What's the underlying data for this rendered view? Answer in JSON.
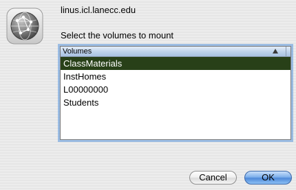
{
  "dialog": {
    "server": "linus.icl.lanecc.edu",
    "prompt": "Select the volumes to mount",
    "icon": "network-server-globe-icon"
  },
  "volumes_list": {
    "header": "Volumes",
    "sort_icon": "sort-ascending-icon",
    "items": [
      {
        "label": "ClassMaterials",
        "selected": true
      },
      {
        "label": "InstHomes",
        "selected": false
      },
      {
        "label": "L00000000",
        "selected": false
      },
      {
        "label": "Students",
        "selected": false
      }
    ],
    "selection_color": "#284018"
  },
  "buttons": {
    "cancel": "Cancel",
    "ok": "OK"
  }
}
